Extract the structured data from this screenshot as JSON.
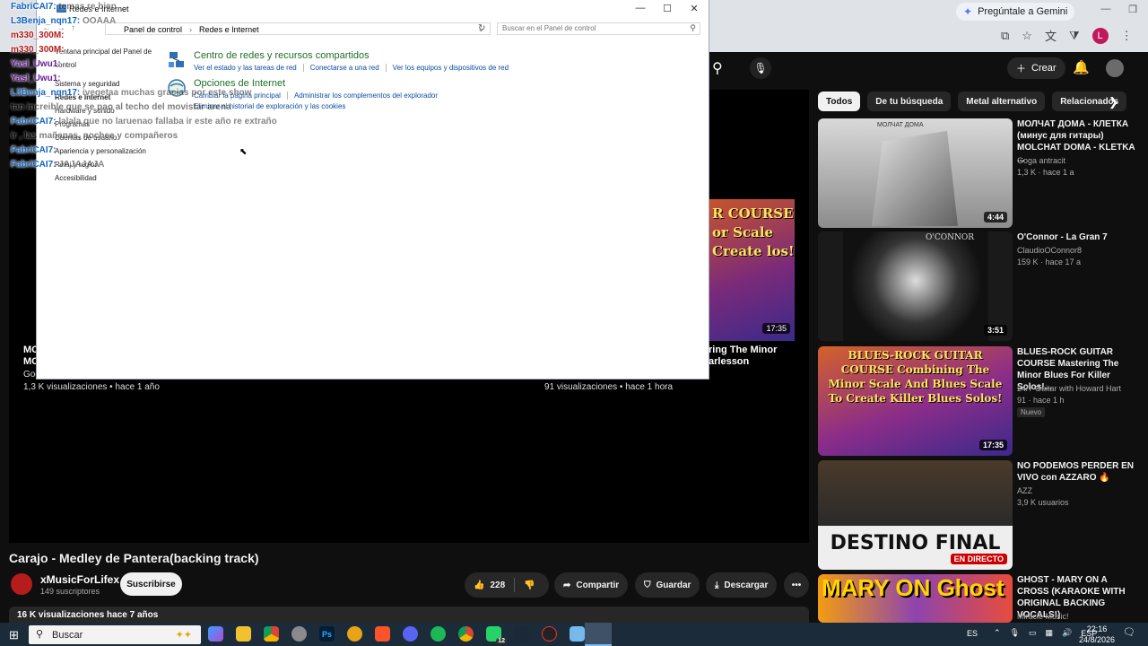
{
  "chrome": {
    "gemini_label": "Pregúntale a Gemini",
    "profile_initial": "L"
  },
  "youtube": {
    "create_label": "Crear",
    "chips": [
      "Todos",
      "De tu búsqueda",
      "Metal alternativo",
      "Relacionados"
    ],
    "recommendations": [
      {
        "title": "МОЛЧАТ ДОМА - КЛЕТКА (минус для гитары) MOLCHAT DOMA - KLETKA ...",
        "channel": "Goga antracit",
        "meta": "1,3 K · hace 1 a",
        "duration": "4:44",
        "thumb_text": "МОЛЧАТ ДОМА"
      },
      {
        "title": "O'Connor - La Gran 7",
        "channel": "ClaudioOConnor8",
        "meta": "159 K · hace 17 a",
        "duration": "3:51",
        "thumb_text": "O'CONNOR"
      },
      {
        "title": "BLUES-ROCK GUITAR COURSE Mastering The Minor Blues For Killer Solos!...",
        "channel": "24/7 Guitar with Howard Hart",
        "meta": "91 · hace 1 h",
        "badge": "Nuevo",
        "duration": "17:35",
        "thumb_text": "BLUES-ROCK GUITAR COURSE Combining The Minor Scale And Blues Scale To Create Killer Blues Solos!"
      },
      {
        "title": "NO PODEMOS PERDER EN VIVO con AZZARO 🔥",
        "channel": "AZZ",
        "meta": "3,9 K usuarios",
        "live": "EN DIRECTO",
        "thumb_text": "DESTINO FINAL"
      },
      {
        "title": "GHOST - MARY ON A CROSS (KARAOKE WITH ORIGINAL BACKING VOCALS!)",
        "channel": "Miracle Music!",
        "meta": "",
        "thumb_text": "MARY ON Ghost"
      }
    ],
    "player": {
      "endcard_left_title": "MO MO",
      "endcard_left_channel": "Gog",
      "endcard_left_meta": "1,3 K visualizaciones • hace 1 año",
      "endcard_right_title": "ring The Minor arlesson",
      "endcard_right_meta": "91 visualizaciones • hace 1 hora",
      "endcard_card_text": "R COURSE or Scale Create los!",
      "endcard_card_duration": "17:35"
    },
    "video": {
      "title": "Carajo - Medley de Pantera(backing track)",
      "channel": "xMusicForLifex",
      "subscribers": "149 suscriptores",
      "subscribe_label": "Suscribirse",
      "likes": "228",
      "share_label": "Compartir",
      "save_label": "Guardar",
      "download_label": "Descargar",
      "views_line": "16 K visualizaciones  hace 7 años"
    }
  },
  "control_panel": {
    "window_title": "Redes e Internet",
    "breadcrumb": [
      "Panel de control",
      "Redes e Internet"
    ],
    "search_placeholder": "Buscar en el Panel de control",
    "nav_items": [
      "Ventana principal del Panel de",
      "control",
      "Sistema y seguridad",
      "Redes e Internet",
      "Hardware y sonido",
      "Programas",
      "Cuentas de usuario",
      "Apariencia y personalización",
      "Reloj y región",
      "Accesibilidad"
    ],
    "sections": [
      {
        "heading": "Centro de redes y recursos compartidos",
        "links": [
          "Ver el estado y las tareas de red",
          "Conectarse a una red",
          "Ver los equipos y dispositivos de red"
        ],
        "links2": ""
      },
      {
        "heading": "Opciones de Internet",
        "links": [
          "Cambiar la página principal",
          "Administrar los complementos del explorador"
        ],
        "links2": "Eliminar el historial de exploración y las cookies"
      }
    ]
  },
  "chat": [
    {
      "user": "FabriCAI7:",
      "msg": "temas re bien",
      "color": "blue"
    },
    {
      "user": "L3Benja_nqn17:",
      "msg": "OOAAA",
      "color": "blue"
    },
    {
      "user": "m330_300M:",
      "msg": "",
      "color": "red"
    },
    {
      "user": "m330_300M:",
      "msg": "",
      "color": "red"
    },
    {
      "user": "Yasl_Uwu1:",
      "msg": "",
      "color": "purple"
    },
    {
      "user": "Yasl_Uwu1:",
      "msg": "",
      "color": "purple"
    },
    {
      "user": "L3Benja_nqn17:",
      "msg": "ivegetaa muchas gracias por este show",
      "color": "blue"
    },
    {
      "user": "",
      "msg": "tan increible que se pao al techo del movistar arena",
      "color": "blue"
    },
    {
      "user": "FabriCAI7:",
      "msg": "lalala que no laruenao fallaba ir este año re extraño",
      "color": "blue"
    },
    {
      "user": "",
      "msg": "ir , las mañanas, nochee y compañeros",
      "color": "blue"
    },
    {
      "user": "FabriCAI7:",
      "msg": "",
      "color": "blue"
    },
    {
      "user": "FabriCAI7:",
      "msg": "JAJAJAJA",
      "color": "blue"
    }
  ],
  "taskbar": {
    "search_label": "Buscar",
    "lang": "ES",
    "kb": "ESP",
    "time": "22:16",
    "date": "24/8/2026",
    "badge_count": "12"
  }
}
